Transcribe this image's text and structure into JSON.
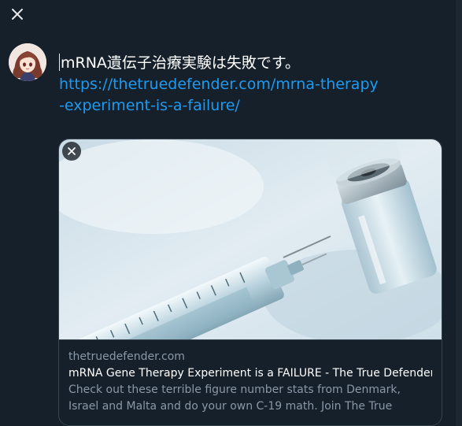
{
  "close_icon": "close-icon",
  "tweet": {
    "text": "mRNA遺伝子治療実験は失敗です。",
    "link": "https://thetruedefender.com/mrna-therapy-experiment-is-a-failure/"
  },
  "card": {
    "domain": "thetruedefender.com",
    "title": "mRNA Gene Therapy Experiment is a FAILURE - The True Defender !",
    "description": "Check out these terrible figure number stats from Denmark, Israel and Malta and do your own C-19 math. Join The True Defender ..."
  },
  "colors": {
    "background": "#15202b",
    "link": "#1d9bf0",
    "muted": "#8b98a5",
    "border": "#38444d"
  }
}
